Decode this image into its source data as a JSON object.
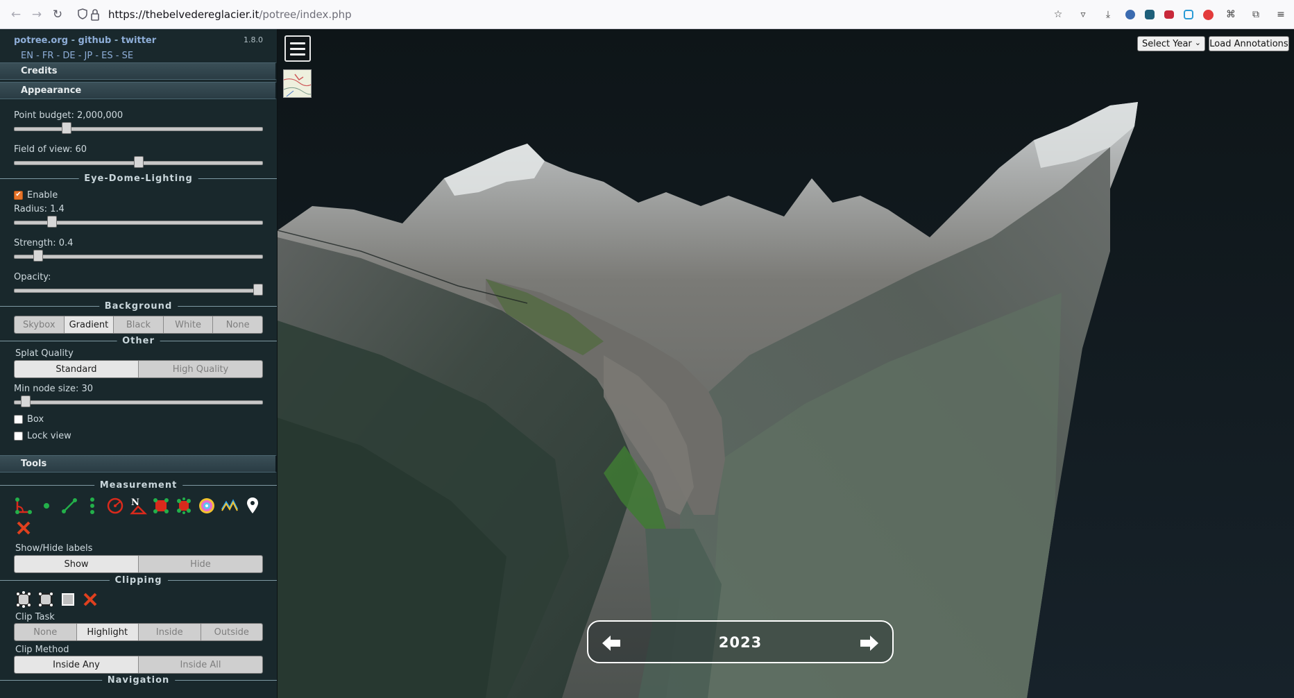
{
  "browser": {
    "url_host": "https://thebelvedereglacier.it",
    "url_path": "/potree/index.php"
  },
  "sidebar": {
    "links": [
      "potree.org",
      "github",
      "twitter"
    ],
    "link_sep": " - ",
    "version": "1.8.0",
    "languages": "EN - FR - DE - JP - ES - SE",
    "credits_label": "Credits",
    "appearance_label": "Appearance",
    "point_budget_label": "Point budget: 2,000,000",
    "point_budget_level": 0.2,
    "fov_label": "Field of view: 60",
    "fov_level": 0.5,
    "edl_heading": "Eye-Dome-Lighting",
    "edl_enable_label": "Enable",
    "edl_enabled": true,
    "radius_label": "Radius: 1.4",
    "radius_level": 0.14,
    "strength_label": "Strength: 0.4",
    "strength_level": 0.08,
    "opacity_label": "Opacity:",
    "opacity_level": 1.0,
    "background_heading": "Background",
    "background_options": [
      "Skybox",
      "Gradient",
      "Black",
      "White",
      "None"
    ],
    "background_selected": "Gradient",
    "other_heading": "Other",
    "splat_quality_label": "Splat Quality",
    "splat_options": [
      "Standard",
      "High Quality"
    ],
    "splat_selected": "Standard",
    "min_node_label": "Min node size: 30",
    "min_node_level": 0.03,
    "box_label": "Box",
    "lock_view_label": "Lock view",
    "tools_label": "Tools",
    "measurement_heading": "Measurement",
    "show_hide_label": "Show/Hide labels",
    "show_hide_options": [
      "Show",
      "Hide"
    ],
    "show_hide_selected": "Show",
    "clipping_heading": "Clipping",
    "clip_task_label": "Clip Task",
    "clip_task_options": [
      "None",
      "Highlight",
      "Inside",
      "Outside"
    ],
    "clip_task_selected": "Highlight",
    "clip_method_label": "Clip Method",
    "clip_method_options": [
      "Inside Any",
      "Inside All"
    ],
    "clip_method_selected": "Inside Any",
    "navigation_heading": "Navigation"
  },
  "viewer": {
    "select_year_label": "Select Year",
    "load_annotations_label": "Load Annotations",
    "current_year": "2023"
  }
}
